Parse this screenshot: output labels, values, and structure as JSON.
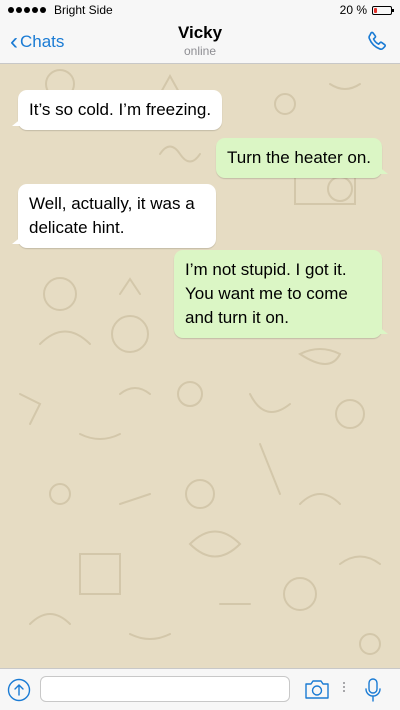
{
  "status_bar": {
    "carrier": "Bright Side",
    "battery_text": "20 %",
    "battery_level": 0.2,
    "battery_color": "#e4312b"
  },
  "header": {
    "back_label": "Chats",
    "contact_name": "Vicky",
    "contact_status": "online",
    "back_icon": "chevron-left-icon",
    "call_icon": "phone-icon"
  },
  "messages": [
    {
      "direction": "incoming",
      "text": "It’s so cold. I’m freezing."
    },
    {
      "direction": "outgoing",
      "text": "Turn the heater on."
    },
    {
      "direction": "incoming",
      "text": "Well, actually, it was a delicate hint."
    },
    {
      "direction": "outgoing",
      "text": "I’m not stupid. I got it. You want me to come and turn it on."
    }
  ],
  "input_bar": {
    "placeholder": "",
    "attach_icon": "upload-icon",
    "camera_icon": "camera-icon",
    "mic_icon": "microphone-icon"
  },
  "colors": {
    "accent": "#1a7bd4",
    "chat_background": "#e6dcc3",
    "incoming_bubble": "#ffffff",
    "outgoing_bubble": "#dbf6c5"
  }
}
